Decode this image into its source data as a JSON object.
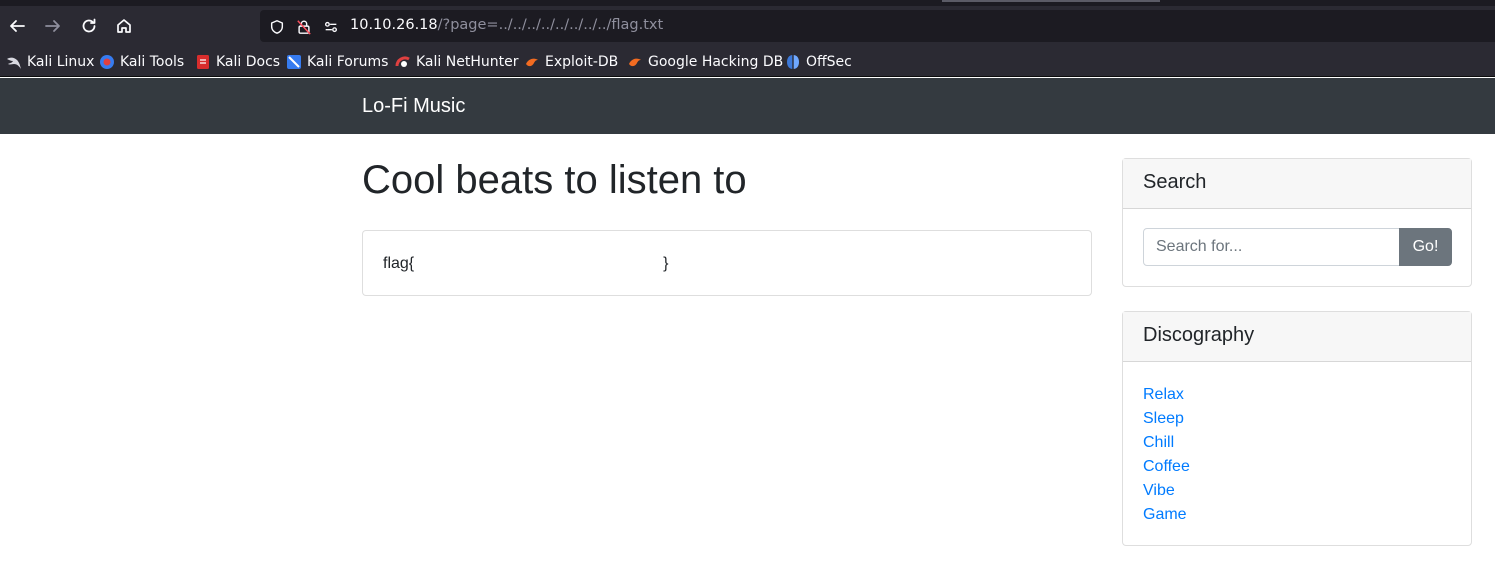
{
  "browser": {
    "url": {
      "host": "10.10.26.18",
      "path": "/?page=../../../../../../../../flag.txt"
    },
    "icons": [
      "back-icon",
      "forward-icon",
      "reload-icon",
      "home-icon",
      "shield-icon",
      "lock-icon",
      "permissions-icon"
    ],
    "bookmarks": [
      {
        "label": "Kali Linux",
        "icon": "kali-dragon-icon"
      },
      {
        "label": "Kali Tools",
        "icon": "kali-tools-icon"
      },
      {
        "label": "Kali Docs",
        "icon": "kali-docs-icon"
      },
      {
        "label": "Kali Forums",
        "icon": "kali-forums-icon"
      },
      {
        "label": "Kali NetHunter",
        "icon": "nethunter-icon"
      },
      {
        "label": "Exploit-DB",
        "icon": "exploit-db-icon"
      },
      {
        "label": "Google Hacking DB",
        "icon": "ghdb-icon"
      },
      {
        "label": "OffSec",
        "icon": "offsec-icon"
      }
    ]
  },
  "site": {
    "brand": "Lo-Fi Music",
    "title": "Cool beats to listen to",
    "flag_text": "flag{                                                        }",
    "search": {
      "header": "Search",
      "placeholder": "Search for...",
      "button": "Go!"
    },
    "discography": {
      "header": "Discography",
      "items": [
        "Relax",
        "Sleep",
        "Chill",
        "Coffee",
        "Vibe",
        "Game"
      ]
    }
  },
  "colors": {
    "navbar": "#343a40",
    "link": "#007bff",
    "button": "#6c757d",
    "chrome": "#2b2a33"
  }
}
